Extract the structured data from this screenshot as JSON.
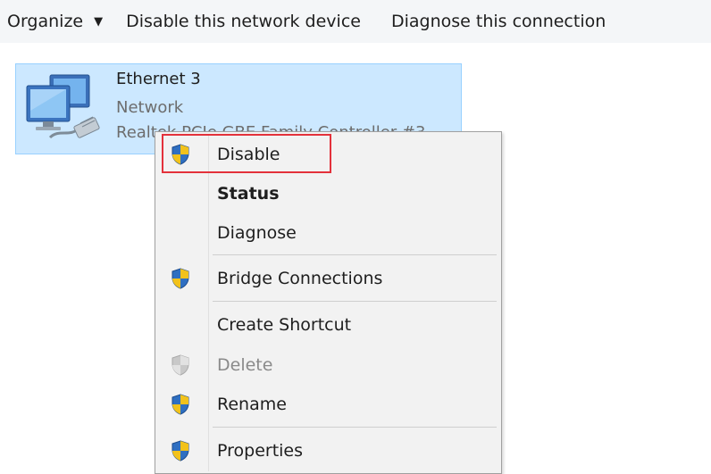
{
  "toolbar": {
    "organize_label": "Organize",
    "organize_arrow": "▼",
    "disable_device_label": "Disable this network device",
    "diagnose_label": "Diagnose this connection"
  },
  "network_item": {
    "name": "Ethernet 3",
    "status": "Network",
    "device": "Realtek PCIe GBE Family Controller #3",
    "icon": "network-adapter-icon",
    "selected": true
  },
  "context_menu": {
    "items": [
      {
        "label": "Disable",
        "icon": "uac-shield-icon",
        "style": "normal",
        "highlighted": true
      },
      {
        "label": "Status",
        "icon": "",
        "style": "bold"
      },
      {
        "label": "Diagnose",
        "icon": "",
        "style": "normal"
      },
      {
        "label": "Bridge Connections",
        "icon": "uac-shield-icon",
        "style": "normal"
      },
      {
        "label": "Create Shortcut",
        "icon": "",
        "style": "normal"
      },
      {
        "label": "Delete",
        "icon": "uac-shield-icon",
        "style": "disabled"
      },
      {
        "label": "Rename",
        "icon": "uac-shield-icon",
        "style": "normal"
      },
      {
        "label": "Properties",
        "icon": "uac-shield-icon",
        "style": "normal"
      }
    ]
  },
  "colors": {
    "toolbar_bg": "#f4f6f8",
    "selection_bg": "#cce8ff",
    "selection_border": "#99d1ff",
    "menu_bg": "#f2f2f2",
    "highlight_red": "#e3313b",
    "shield_blue": "#2f6fc1",
    "shield_yellow": "#f2c21b"
  }
}
